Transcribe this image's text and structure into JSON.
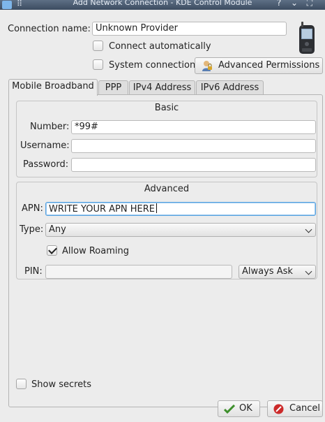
{
  "window": {
    "title": "Add Network Connection - KDE Control Module",
    "help_glyph": "?",
    "minimize_glyph": "⌄",
    "maximize_glyph": "⛶",
    "menu_glyph": "⠿"
  },
  "connection": {
    "name_label": "Connection name:",
    "name_value": "Unknown Provider",
    "connect_auto_label": "Connect automatically",
    "connect_auto_checked": false,
    "system_connection_label": "System connection",
    "system_connection_checked": false,
    "advanced_permissions_label": "Advanced Permissions"
  },
  "tabs": [
    {
      "label": "Mobile Broadband",
      "active": true
    },
    {
      "label": "PPP",
      "active": false
    },
    {
      "label": "IPv4 Address",
      "active": false
    },
    {
      "label": "IPv6 Address",
      "active": false
    }
  ],
  "basic": {
    "title": "Basic",
    "number_label": "Number:",
    "number_value": "*99#",
    "username_label": "Username:",
    "username_value": "",
    "password_label": "Password:",
    "password_value": ""
  },
  "advanced": {
    "title": "Advanced",
    "apn_label": "APN:",
    "apn_value": "WRITE YOUR APN HERE",
    "type_label": "Type:",
    "type_value": "Any",
    "allow_roaming_label": "Allow Roaming",
    "allow_roaming_checked": true,
    "pin_label": "PIN:",
    "pin_value": "",
    "pin_mode_value": "Always Ask"
  },
  "footer": {
    "show_secrets_label": "Show secrets",
    "show_secrets_checked": false,
    "ok_label": "OK",
    "cancel_label": "Cancel"
  },
  "colors": {
    "titlebar": "#4a5b70",
    "focus": "#58a3e0",
    "ok_icon": "#3e8f2c",
    "cancel_icon": "#cc2a2a"
  }
}
